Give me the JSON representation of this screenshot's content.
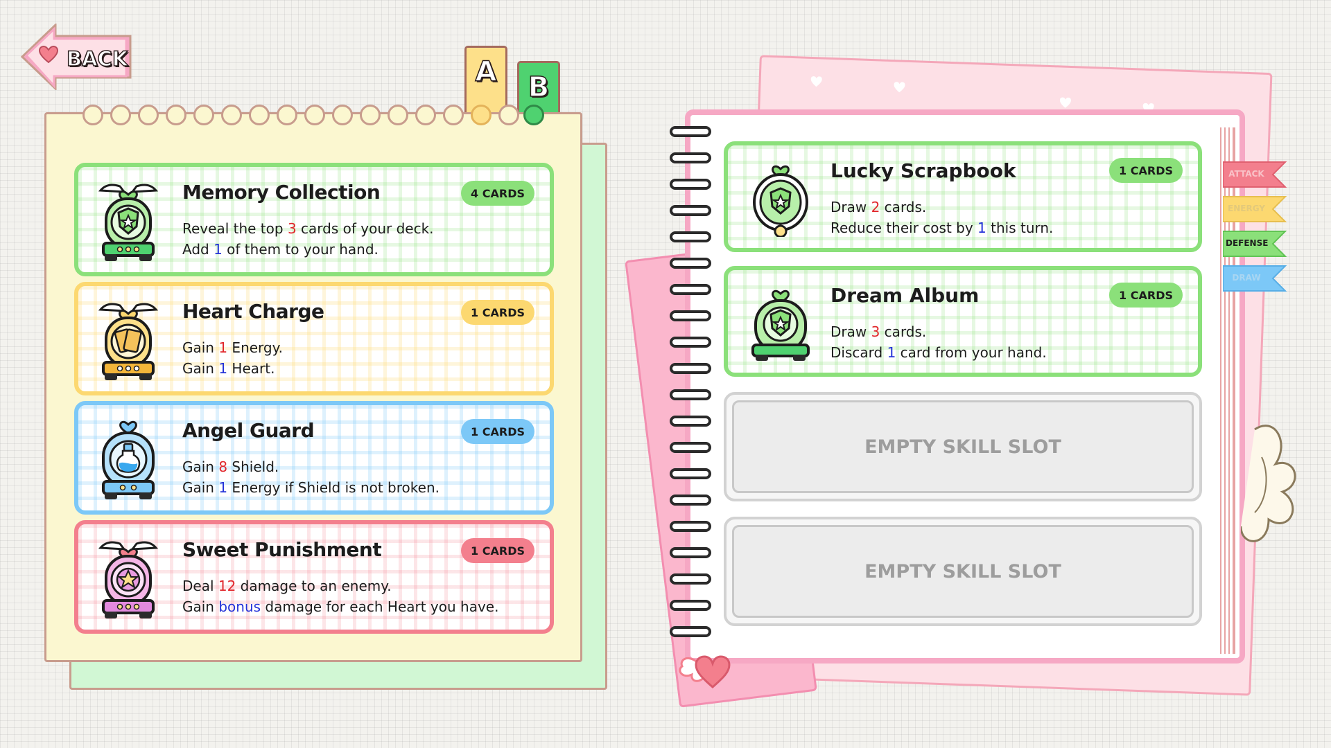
{
  "nav": {
    "back_label": "BACK"
  },
  "deck_tabs": [
    {
      "label": "A",
      "active": false
    },
    {
      "label": "B",
      "active": true
    }
  ],
  "deck_cards": [
    {
      "title": "Memory Collection",
      "badge": "4 CARDS",
      "theme": "green",
      "lines": [
        [
          {
            "t": "Reveal the top "
          },
          {
            "t": "3",
            "c": "red"
          },
          {
            "t": " cards of your deck."
          }
        ],
        [
          {
            "t": "Add "
          },
          {
            "t": "1",
            "c": "blue"
          },
          {
            "t": " of them to your hand."
          }
        ]
      ]
    },
    {
      "title": "Heart Charge",
      "badge": "1 CARDS",
      "theme": "yellow",
      "lines": [
        [
          {
            "t": "Gain "
          },
          {
            "t": "1",
            "c": "red"
          },
          {
            "t": " Energy."
          }
        ],
        [
          {
            "t": "Gain "
          },
          {
            "t": "1",
            "c": "blue"
          },
          {
            "t": " Heart."
          }
        ]
      ]
    },
    {
      "title": "Angel Guard",
      "badge": "1 CARDS",
      "theme": "blue",
      "lines": [
        [
          {
            "t": "Gain "
          },
          {
            "t": "8",
            "c": "red"
          },
          {
            "t": " Shield."
          }
        ],
        [
          {
            "t": "Gain "
          },
          {
            "t": "1",
            "c": "blue"
          },
          {
            "t": " Energy if Shield is not broken."
          }
        ]
      ]
    },
    {
      "title": "Sweet Punishment",
      "badge": "1 CARDS",
      "theme": "pink",
      "lines": [
        [
          {
            "t": "Deal "
          },
          {
            "t": "12",
            "c": "red"
          },
          {
            "t": " damage to an enemy."
          }
        ],
        [
          {
            "t": "Gain "
          },
          {
            "t": "bonus",
            "c": "blue"
          },
          {
            "t": " damage for each Heart you have."
          }
        ]
      ]
    }
  ],
  "skill_cards": [
    {
      "title": "Lucky Scrapbook",
      "badge": "1 CARDS",
      "lines": [
        [
          {
            "t": "Draw "
          },
          {
            "t": "2",
            "c": "red"
          },
          {
            "t": " cards."
          }
        ],
        [
          {
            "t": "Reduce their cost by "
          },
          {
            "t": "1",
            "c": "blue"
          },
          {
            "t": " this turn."
          }
        ]
      ]
    },
    {
      "title": "Dream Album",
      "badge": "1 CARDS",
      "lines": [
        [
          {
            "t": "Draw "
          },
          {
            "t": "3",
            "c": "red"
          },
          {
            "t": " cards."
          }
        ],
        [
          {
            "t": "Discard "
          },
          {
            "t": "1",
            "c": "blue"
          },
          {
            "t": " card from your hand."
          }
        ]
      ]
    }
  ],
  "empty_slots": [
    {
      "label": "EMPTY SKILL SLOT"
    },
    {
      "label": "EMPTY SKILL SLOT"
    }
  ],
  "filter_tabs": [
    {
      "label": "ATTACK",
      "color": "#f37f8d",
      "text_color": "#e8a3ad"
    },
    {
      "label": "ENERGY",
      "color": "#fcd870",
      "text_color": "#d9c58a"
    },
    {
      "label": "DEFENSE",
      "color": "#8be07a",
      "text_color": "#1c1c1c"
    },
    {
      "label": "DRAW",
      "color": "#7cc8f7",
      "text_color": "#8fb6d0"
    }
  ],
  "colors": {
    "red": "#e1262b",
    "blue": "#2432d8",
    "green": "#8be07a",
    "yellow": "#fcd870",
    "sky": "#7cc8f7",
    "pink": "#f37f8d"
  }
}
